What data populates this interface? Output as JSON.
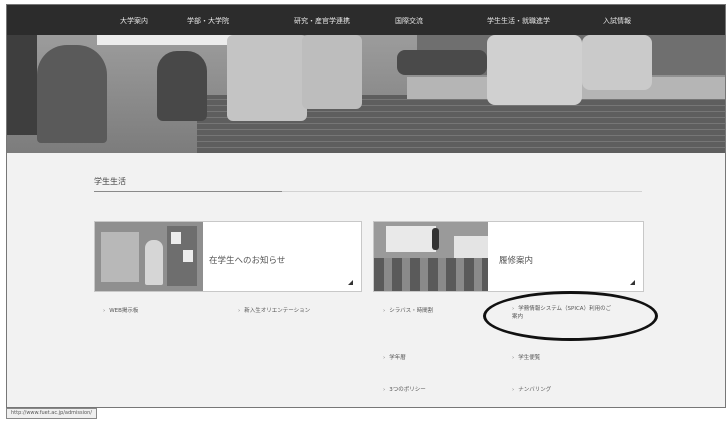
{
  "nav": {
    "items": [
      "大学案内",
      "学部・大学院",
      "研究・産官学連携",
      "国際交流",
      "学生生活・就職進学",
      "入試情報"
    ]
  },
  "section": {
    "title": "学生生活"
  },
  "cards": {
    "left": {
      "title": "在学生へのお知らせ"
    },
    "right": {
      "title": "履修案内"
    }
  },
  "links": {
    "left": [
      "WEB掲示板",
      "新入生オリエンテーション"
    ],
    "right": [
      "シラバス・時間割",
      "学務情報システム（SPICA）利用のご案内",
      "学年暦",
      "学生便覧",
      "3つのポリシー",
      "ナンバリング"
    ]
  },
  "status": {
    "url": "http://www.fuet.ac.jp/admission/"
  },
  "colors": {
    "nav_bg": "#2c2c2c",
    "page_bg": "#f2f2f2",
    "annotation": "#111111"
  }
}
